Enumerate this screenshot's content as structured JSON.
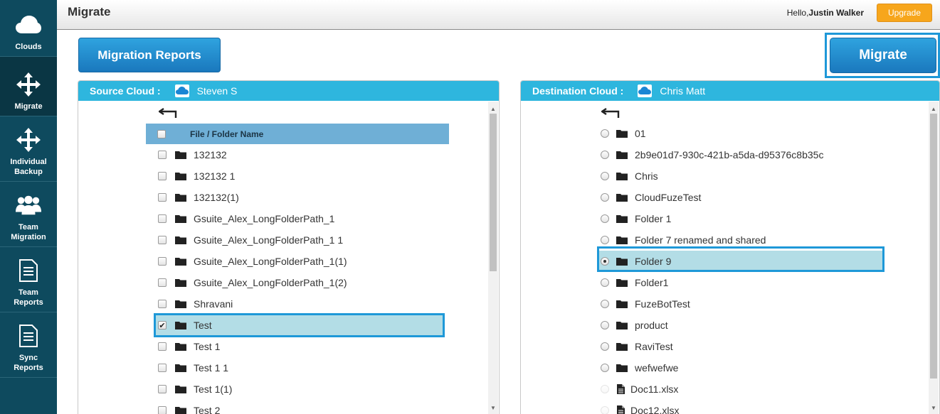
{
  "header": {
    "title": "Migrate",
    "greeting_prefix": "Hello,",
    "user_name": "Justin Walker",
    "upgrade_label": "Upgrade"
  },
  "sidebar": {
    "items": [
      {
        "label": "Clouds",
        "icon": "cloud-icon"
      },
      {
        "label": "Migrate",
        "icon": "move-arrows-icon",
        "active": true
      },
      {
        "label": "Individual Backup",
        "icon": "move-arrows-icon"
      },
      {
        "label": "Team Migration",
        "icon": "users-group-icon"
      },
      {
        "label": "Team Reports",
        "icon": "document-icon"
      },
      {
        "label": "Sync Reports",
        "icon": "document-icon"
      }
    ]
  },
  "toolbar": {
    "migration_reports_label": "Migration Reports",
    "migrate_label": "Migrate"
  },
  "source": {
    "heading": "Source Cloud :",
    "account": "Steven S",
    "column_header": "File / Folder Name",
    "items": [
      {
        "name": "132132",
        "checked": false
      },
      {
        "name": "132132 1",
        "checked": false
      },
      {
        "name": "132132(1)",
        "checked": false
      },
      {
        "name": "Gsuite_Alex_LongFolderPath_1",
        "checked": false
      },
      {
        "name": "Gsuite_Alex_LongFolderPath_1 1",
        "checked": false
      },
      {
        "name": "Gsuite_Alex_LongFolderPath_1(1)",
        "checked": false
      },
      {
        "name": "Gsuite_Alex_LongFolderPath_1(2)",
        "checked": false
      },
      {
        "name": "Shravani",
        "checked": false
      },
      {
        "name": "Test",
        "checked": true
      },
      {
        "name": "Test 1",
        "checked": false
      },
      {
        "name": "Test 1 1",
        "checked": false
      },
      {
        "name": "Test 1(1)",
        "checked": false
      },
      {
        "name": "Test 2",
        "checked": false
      }
    ]
  },
  "destination": {
    "heading": "Destination Cloud :",
    "account": "Chris Matt",
    "items": [
      {
        "name": "01",
        "type": "folder",
        "selected": false
      },
      {
        "name": "2b9e01d7-930c-421b-a5da-d95376c8b35c",
        "type": "folder",
        "selected": false
      },
      {
        "name": "Chris",
        "type": "folder",
        "selected": false
      },
      {
        "name": "CloudFuzeTest",
        "type": "folder",
        "selected": false
      },
      {
        "name": "Folder 1",
        "type": "folder",
        "selected": false
      },
      {
        "name": "Folder 7 renamed and shared",
        "type": "folder",
        "selected": false
      },
      {
        "name": "Folder 9",
        "type": "folder",
        "selected": true
      },
      {
        "name": "Folder1",
        "type": "folder",
        "selected": false
      },
      {
        "name": "FuzeBotTest",
        "type": "folder",
        "selected": false
      },
      {
        "name": "product",
        "type": "folder",
        "selected": false
      },
      {
        "name": "RaviTest",
        "type": "folder",
        "selected": false
      },
      {
        "name": "wefwefwe",
        "type": "folder",
        "selected": false
      },
      {
        "name": "Doc11.xlsx",
        "type": "file",
        "selected": false
      },
      {
        "name": "Doc12.xlsx",
        "type": "file",
        "selected": false
      }
    ]
  },
  "colors": {
    "sidebar_bg": "#0e4a5e",
    "panel_header": "#2eb6de",
    "button_blue": "#1a78bd",
    "upgrade_orange": "#f7a61c",
    "selection_bg": "#b3dde6",
    "highlight_border": "#1e98d8"
  }
}
